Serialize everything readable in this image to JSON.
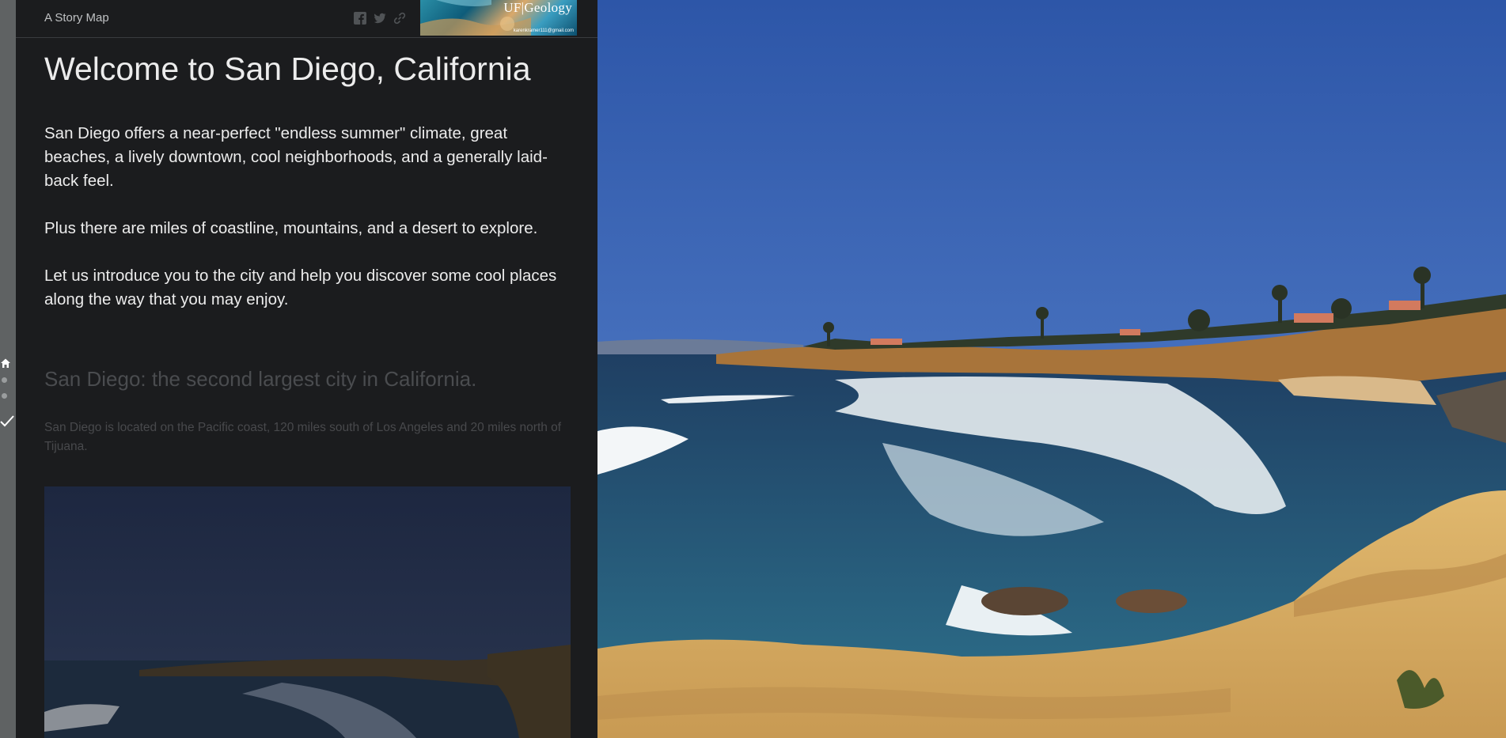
{
  "header": {
    "story_label": "A Story Map",
    "logo_text": "UF|Geology",
    "logo_subtext": "karenkramer111@gmail.com",
    "share_icons": [
      "facebook-icon",
      "twitter-icon",
      "link-icon"
    ]
  },
  "section": {
    "title": "Welcome to San Diego, California",
    "paragraphs": [
      "San Diego offers a near-perfect \"endless summer\" climate, great beaches, a lively downtown, cool neighborhoods, and a generally laid-back feel.",
      "Plus there are miles of coastline, mountains, and a desert to explore.",
      "Let us introduce you to the city and help you discover some cool places along the way that you may enjoy."
    ]
  },
  "next_section": {
    "heading": "San Diego: the second largest city in California.",
    "body": "San Diego is located on the Pacific coast, 120 miles south of Los Angeles and 20 miles north of Tijuana."
  },
  "nav": {
    "icons": [
      "home-icon",
      "dot",
      "dot",
      "check-icon"
    ]
  },
  "colors": {
    "panel_bg": "#1b1c1e",
    "rail_bg": "#5f6263",
    "text": "#ececec",
    "dim_text": "#4a4c4f",
    "sky": "#3e67b4",
    "ocean": "#254a6a",
    "cliff": "#d8ae66"
  }
}
